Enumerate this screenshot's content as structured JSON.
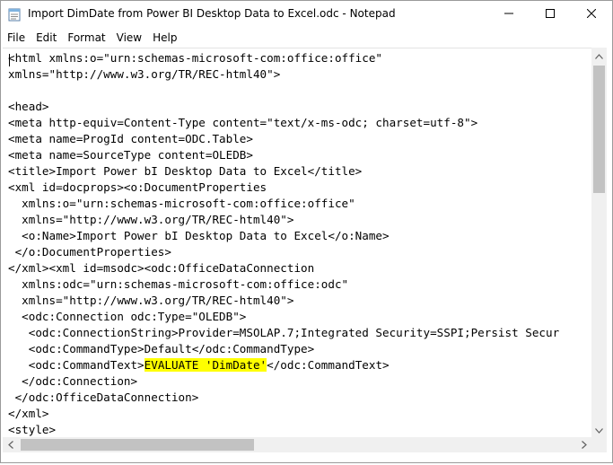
{
  "window": {
    "title": "Import DimDate from Power BI Desktop Data to Excel.odc - Notepad"
  },
  "menu": [
    "File",
    "Edit",
    "Format",
    "View",
    "Help"
  ],
  "editor": {
    "lines": [
      "<html xmlns:o=\"urn:schemas-microsoft-com:office:office\"",
      "xmlns=\"http://www.w3.org/TR/REC-html40\">",
      "",
      "<head>",
      "<meta http-equiv=Content-Type content=\"text/x-ms-odc; charset=utf-8\">",
      "<meta name=ProgId content=ODC.Table>",
      "<meta name=SourceType content=OLEDB>",
      "<title>Import Power bI Desktop Data to Excel</title>",
      "<xml id=docprops><o:DocumentProperties",
      "  xmlns:o=\"urn:schemas-microsoft-com:office:office\"",
      "  xmlns=\"http://www.w3.org/TR/REC-html40\">",
      "  <o:Name>Import Power bI Desktop Data to Excel</o:Name>",
      " </o:DocumentProperties>",
      "</xml><xml id=msodc><odc:OfficeDataConnection",
      "  xmlns:odc=\"urn:schemas-microsoft-com:office:odc\"",
      "  xmlns=\"http://www.w3.org/TR/REC-html40\">",
      "  <odc:Connection odc:Type=\"OLEDB\">",
      "   <odc:ConnectionString>Provider=MSOLAP.7;Integrated Security=SSPI;Persist Secur",
      "   <odc:CommandType>Default</odc:CommandType>",
      "   <odc:CommandText>",
      "  </odc:Connection>",
      " </odc:OfficeDataConnection>",
      "</xml>",
      "<style>"
    ],
    "highlight_line": {
      "before": "   <odc:CommandText>",
      "highlighted": "EVALUATE 'DimDate'",
      "after": "</odc:CommandText>"
    },
    "highlight_color": "#ffff00"
  },
  "icons": {
    "app": "notepad-icon",
    "minimize": "minimize-icon",
    "maximize": "maximize-icon",
    "close": "close-icon"
  }
}
